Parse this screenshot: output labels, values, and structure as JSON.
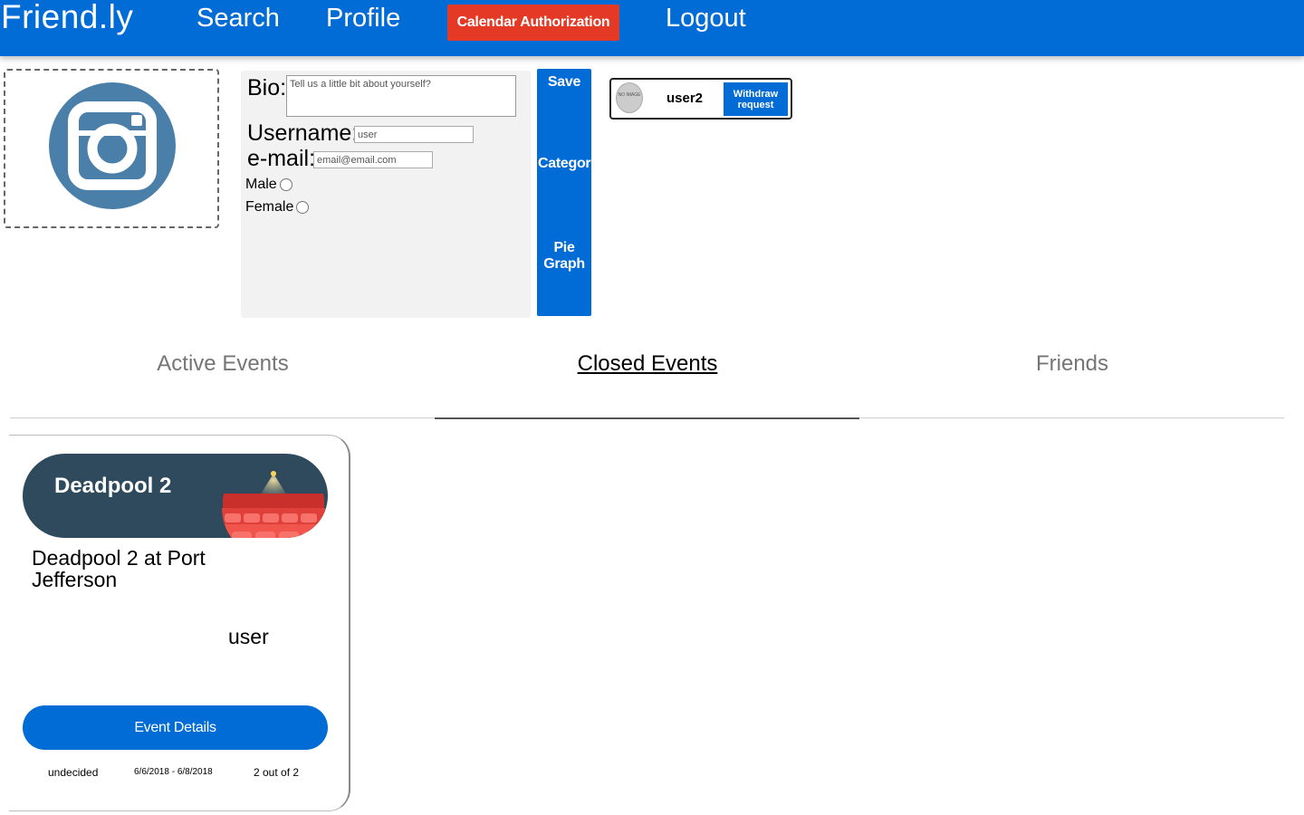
{
  "nav": {
    "brand": "Friend.ly",
    "search": "Search",
    "profile": "Profile",
    "calendar_auth": "Calendar Authorization",
    "logout": "Logout"
  },
  "profile_form": {
    "bio_label": "Bio:",
    "bio_placeholder": "Tell us a little bit about yourself?",
    "username_label": "Username:",
    "username_placeholder": "user",
    "email_label": "e-mail:",
    "email_placeholder": "email@email.com",
    "gender_options": [
      "Male",
      "Female"
    ]
  },
  "actions": {
    "save": "Save",
    "categories": "Categor",
    "pie_graph_line1": "Pie",
    "pie_graph_line2": "Graph"
  },
  "friend_request": {
    "avatar_text": "NO IMAGE",
    "username": "user2",
    "button_line1": "Withdraw",
    "button_line2": "request"
  },
  "tabs": [
    {
      "label": "Active Events",
      "active": false
    },
    {
      "label": "Closed Events",
      "active": true
    },
    {
      "label": "Friends",
      "active": false
    }
  ],
  "event": {
    "title": "Deadpool 2",
    "subtitle": "Deadpool 2 at Port Jefferson",
    "owner": "user",
    "details_button": "Event Details",
    "status": "undecided",
    "date_range": "6/6/2018 - 6/8/2018",
    "attendance": "2 out of 2",
    "icon": "movie-theater-icon"
  },
  "colors": {
    "primary": "#026cd6",
    "danger": "#e43a25",
    "event_header": "#2e4a5c",
    "avatar_icon": "#4a7faa"
  }
}
